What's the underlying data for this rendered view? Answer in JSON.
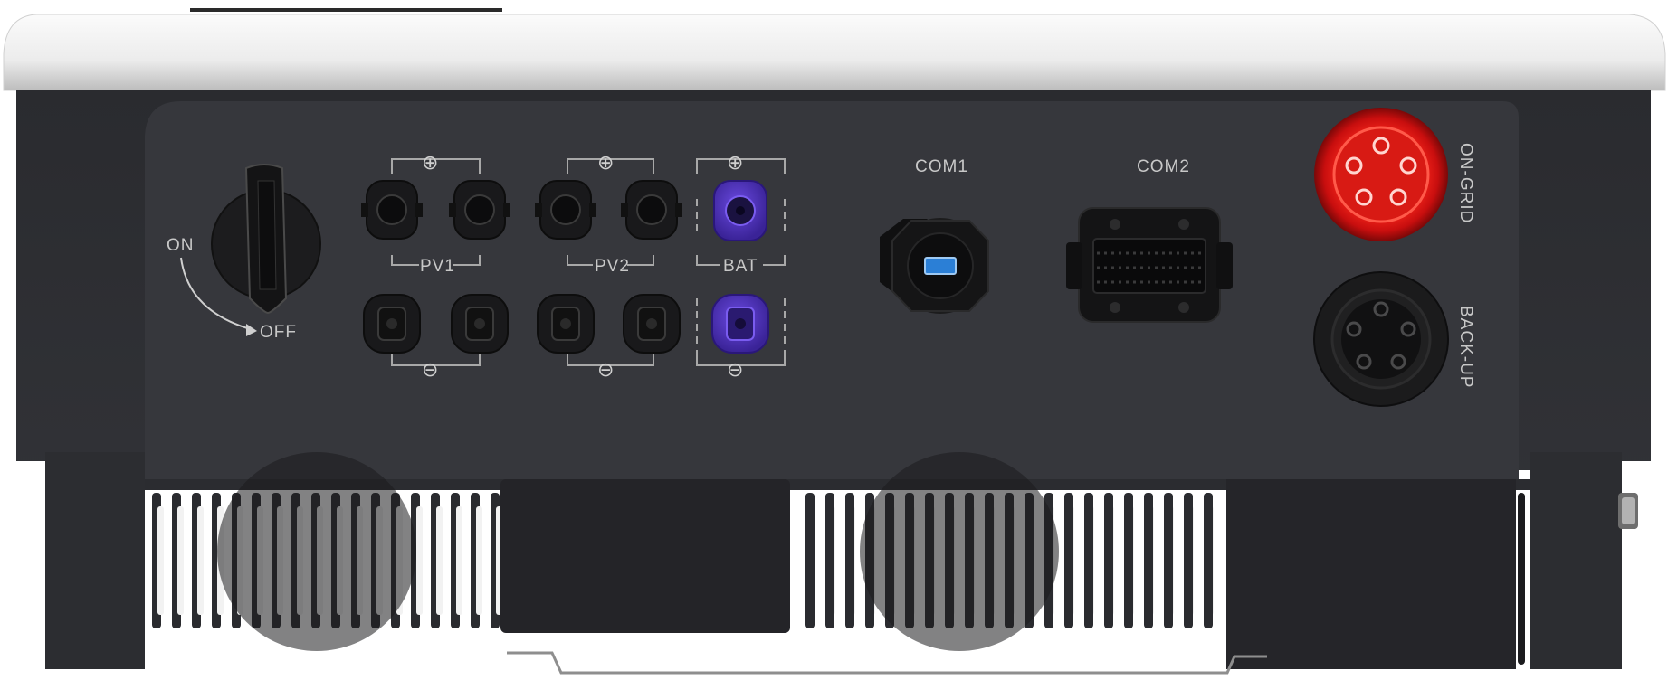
{
  "switch": {
    "on_label": "ON",
    "off_label": "OFF"
  },
  "terminals": {
    "pv1": {
      "label": "PV1",
      "plus": "⊕",
      "minus": "⊖"
    },
    "pv2": {
      "label": "PV2",
      "plus": "⊕",
      "minus": "⊖"
    },
    "bat": {
      "label": "BAT",
      "plus": "⊕",
      "minus": "⊖"
    }
  },
  "ports": {
    "com1": "COM1",
    "com2": "COM2",
    "on_grid": "ON-GRID",
    "back_up": "BACK-UP"
  },
  "colors": {
    "casing": "#2e2f33",
    "panel": "#36373c",
    "lid": "#ececec",
    "bat_connector": "#4b2db5",
    "on_grid_connector": "#e11414"
  }
}
